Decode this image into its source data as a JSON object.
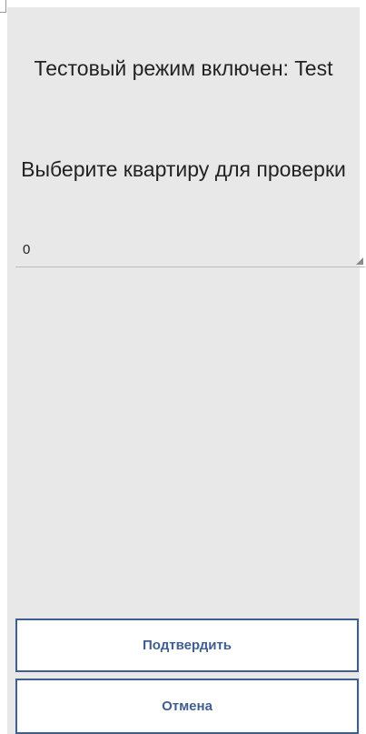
{
  "dialog": {
    "title": "Тестовый режим включен: Test",
    "subtitle": "Выберите квартиру для проверки"
  },
  "spinner": {
    "selected_value": "0"
  },
  "buttons": {
    "confirm_label": "Подтвердить",
    "cancel_label": "Отмена"
  },
  "colors": {
    "dialog_background": "#e8e8e8",
    "button_accent": "#3f5f91",
    "text": "#222222"
  },
  "icons": {
    "spinner_arrow": "dropdown-corner-triangle-icon"
  }
}
